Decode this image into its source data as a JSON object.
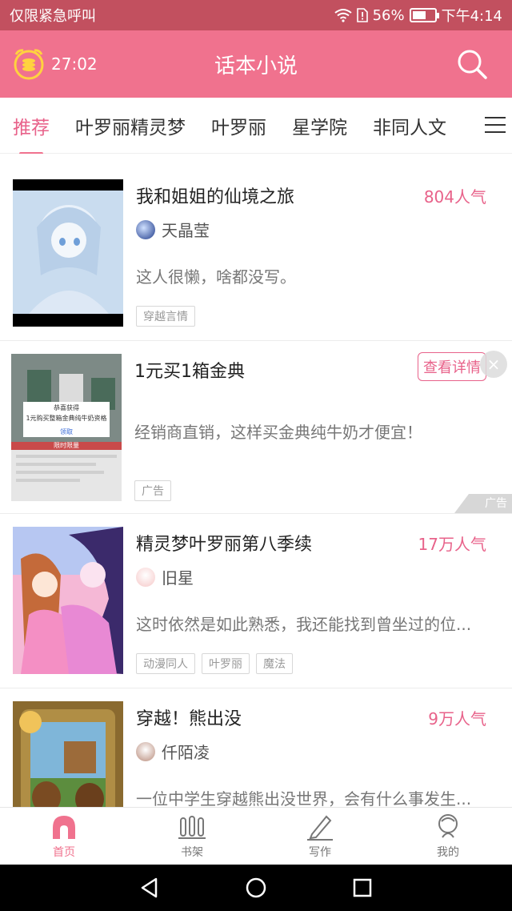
{
  "status_bar": {
    "carrier_text": "仅限紧急呼叫",
    "battery_percent": "56%",
    "time": "下午4:14"
  },
  "header": {
    "timer": "27:02",
    "title": "话本小说"
  },
  "tabs": [
    {
      "label": "推荐"
    },
    {
      "label": "叶罗丽精灵梦"
    },
    {
      "label": "叶罗丽"
    },
    {
      "label": "星学院"
    },
    {
      "label": "非同人文"
    }
  ],
  "feed": {
    "items": [
      {
        "title": "我和姐姐的仙境之旅",
        "popularity": "804人气",
        "author": "天晶莹",
        "desc": "这人很懒，啥都没写。",
        "tags": [
          "穿越言情"
        ]
      },
      {
        "ad_title": "1元买1箱金典",
        "ad_desc": "经销商直销，这样买金典纯牛奶才便宜！",
        "ad_button": "查看详情",
        "ad_tag": "广告",
        "ad_corner": "广告",
        "ad_image": {
          "popup_title": "恭喜获得",
          "popup_text": "1元购买整箱金典纯牛奶资格",
          "popup_button": "领取",
          "banner": "限时限量"
        }
      },
      {
        "title": "精灵梦叶罗丽第八季续",
        "popularity": "17万人气",
        "author": "旧星",
        "desc": "这时依然是如此熟悉，我还能找到曾坐过的位...",
        "tags": [
          "动漫同人",
          "叶罗丽",
          "魔法"
        ]
      },
      {
        "title": "穿越！熊出没",
        "popularity": "9万人气",
        "author": "仟陌凌",
        "desc": "一位中学生穿越熊出没世界，会有什么事发生...",
        "tags": []
      }
    ]
  },
  "bottom_nav": [
    {
      "label": "首页",
      "icon": "home-icon"
    },
    {
      "label": "书架",
      "icon": "bookshelf-icon"
    },
    {
      "label": "写作",
      "icon": "pencil-icon"
    },
    {
      "label": "我的",
      "icon": "profile-icon"
    }
  ],
  "colors": {
    "status_bar": "#c2505f",
    "header": "#f0728e",
    "accent": "#e8628a"
  }
}
